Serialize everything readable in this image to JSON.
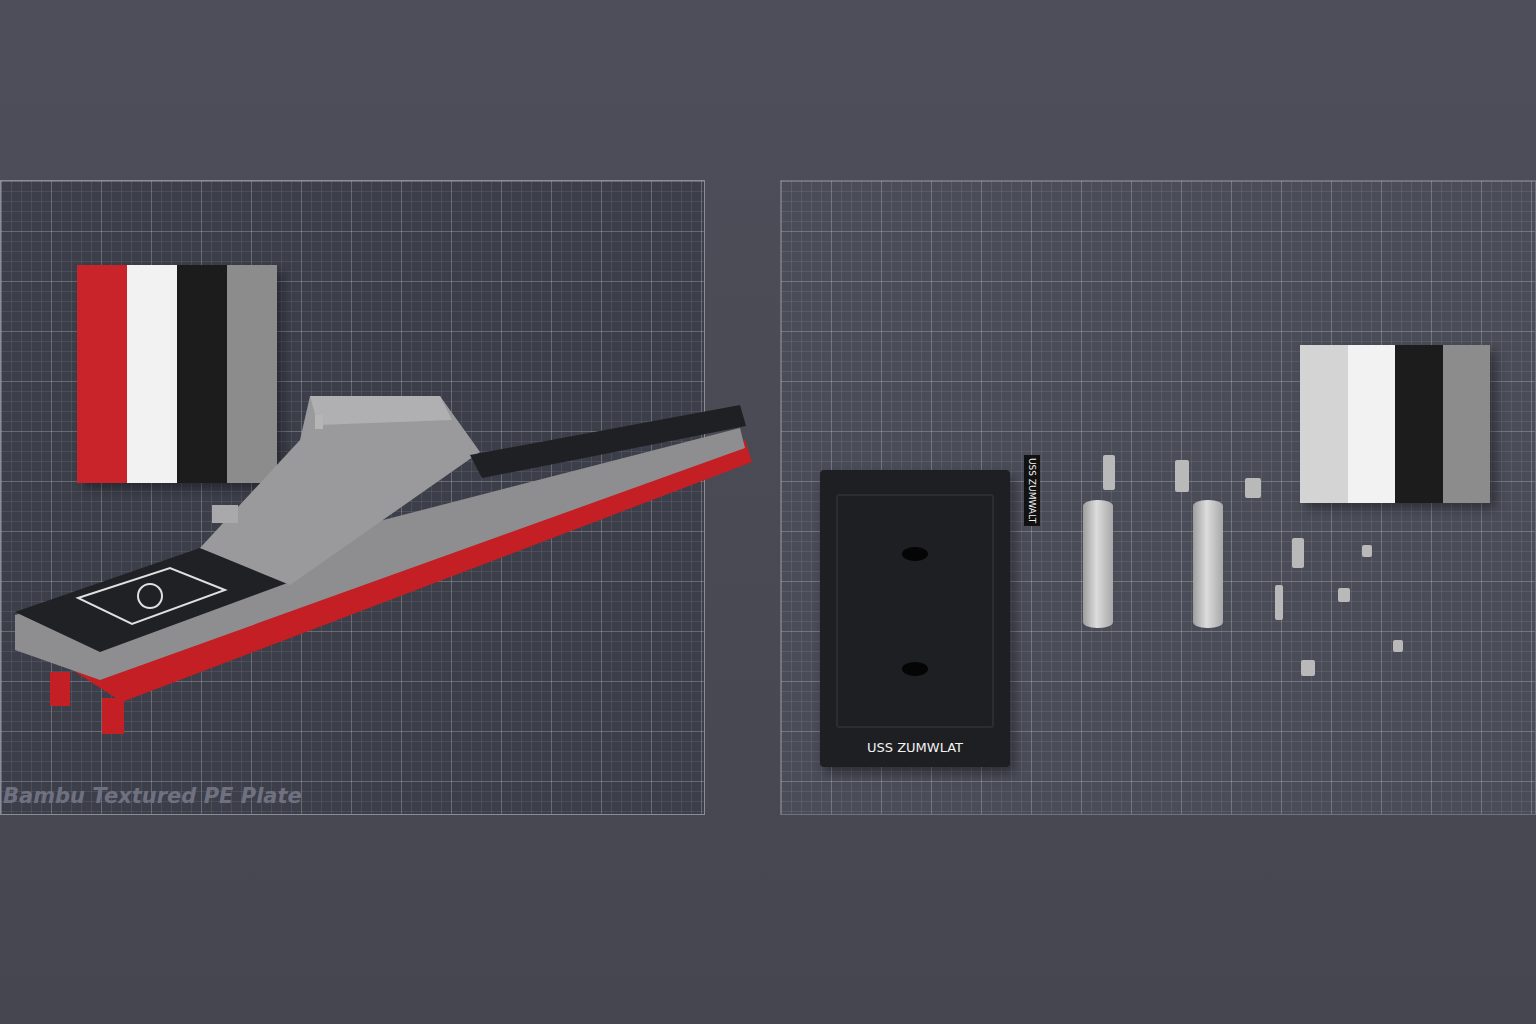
{
  "viewport": {
    "plates": [
      {
        "label": "Bambu Textured PE Plate",
        "selected": true
      },
      {
        "selected": false
      }
    ]
  },
  "prime_towers": [
    {
      "stripes": [
        "#c8242a",
        "#f2f2f2",
        "#1c1c1c",
        "#8c8c8c"
      ]
    },
    {
      "stripes": [
        "#d4d4d4",
        "#f2f2f2",
        "#1c1c1c",
        "#8c8c8c"
      ]
    }
  ],
  "stand": {
    "label": "USS ZUMWLAT"
  },
  "nameplate": {
    "label": "USS ZUMWALT"
  }
}
